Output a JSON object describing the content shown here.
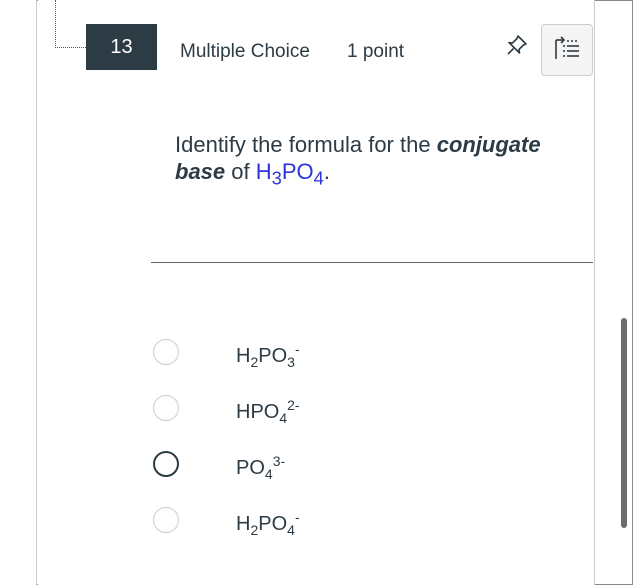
{
  "question": {
    "number": "13",
    "type_label": "Multiple Choice",
    "points_label": "1 point",
    "prompt": {
      "text_1": "Identify the formula for the ",
      "emphasis_1": "conjugate base",
      "text_2": " of ",
      "formula": {
        "a": "H",
        "a_sub": "3",
        "b": "PO",
        "b_sub": "4"
      },
      "text_3": "."
    }
  },
  "options": [
    {
      "base_1": "H",
      "sub_1": "2",
      "base_2": "PO",
      "sub_2": "3",
      "charge": "-"
    },
    {
      "base_1": "HPO",
      "sub_1": "4",
      "base_2": "",
      "sub_2": "",
      "charge": "2-"
    },
    {
      "base_1": "PO",
      "sub_1": "4",
      "base_2": "",
      "sub_2": "",
      "charge": "3-"
    },
    {
      "base_1": "H",
      "sub_1": "2",
      "base_2": "PO",
      "sub_2": "4",
      "charge": "-"
    }
  ],
  "icons": {
    "pin": "pin-icon",
    "flag": "flag-question-icon"
  },
  "colors": {
    "question_number_bg": "#2d3b45",
    "formula_accent": "#2c35d9",
    "text": "#2d3b45"
  }
}
